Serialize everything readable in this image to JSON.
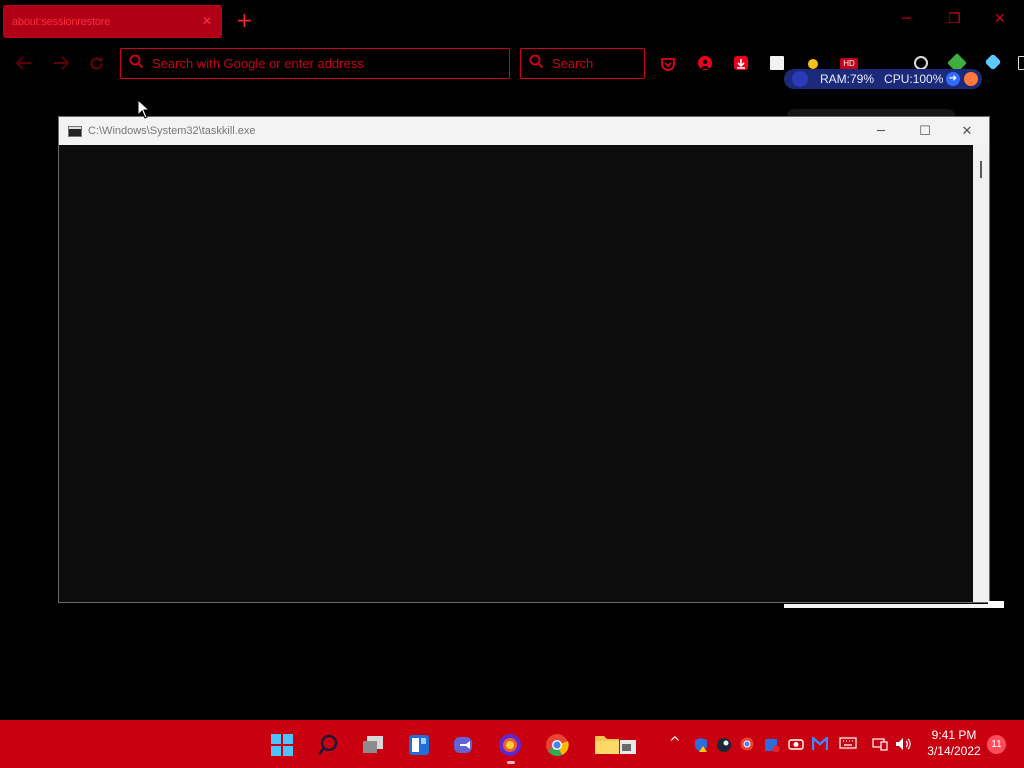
{
  "browser": {
    "tab": {
      "title": "about:sessionrestore",
      "close_glyph": "✕"
    },
    "new_tab_glyph": "+",
    "window_controls": {
      "minimize": "─",
      "restore": "❐",
      "close": "✕"
    },
    "url_placeholder": "Search with Google or enter address",
    "search_placeholder": "Search",
    "extensions": {
      "hd_label": "HD",
      "ram_label": "RAM:79%",
      "cpu_label": "CPU:100%"
    }
  },
  "console": {
    "title": "C:\\Windows\\System32\\taskkill.exe",
    "minimize": "─",
    "maximize": "☐",
    "close": "✕"
  },
  "taskbar": {
    "clock_time": "9:41 PM",
    "clock_date": "3/14/2022",
    "notification_count": "11",
    "tray_chevron": "^"
  },
  "colors": {
    "accent_red": "#c8000f",
    "console_bg": "#0c0c0c",
    "titlebar_bg": "#f3f3f3"
  }
}
